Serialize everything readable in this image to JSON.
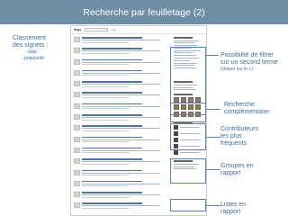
{
  "slide": {
    "title": "Recherche par feuilletage (2)"
  },
  "left_note": {
    "line1": "Classement",
    "line2": "des signets :",
    "options": [
      "- date",
      "- popularité"
    ]
  },
  "annotations": {
    "filter": {
      "line1": "Possibilité de filtrer",
      "line2": "sur un second terme",
      "hint": "(cliquer sur le +)"
    },
    "complement": {
      "line1": "Recherche",
      "line2": "complémentaire"
    },
    "contributors": {
      "line1": "Contributeurs",
      "line2": "les plus",
      "line3": "fréquents"
    },
    "groups": {
      "line1": "Groupes en",
      "line2": "rapport"
    },
    "lists": {
      "line1": "Listes en",
      "line2": "rapport"
    }
  },
  "screenshot": {
    "logo": "diigo",
    "crumb": "tag: ..."
  },
  "colors": {
    "title_bar": "#6e8ea3",
    "accent_text": "#3d6f9a",
    "callout": "#5b84b1"
  }
}
